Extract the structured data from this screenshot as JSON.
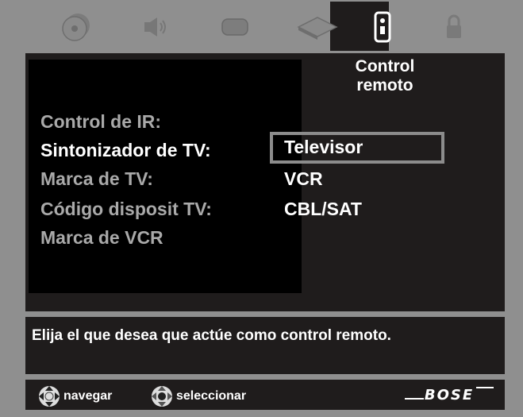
{
  "tabs": [
    {
      "icon": "disc-icon"
    },
    {
      "icon": "speaker-icon"
    },
    {
      "icon": "display-icon"
    },
    {
      "icon": "device-icon"
    },
    {
      "icon": "remote-icon",
      "active": true
    },
    {
      "icon": "lock-icon"
    }
  ],
  "page_title": "Control remoto",
  "menu": {
    "items": [
      {
        "label": "Control de IR:",
        "active": false
      },
      {
        "label": "Sintonizador de TV:",
        "active": true
      },
      {
        "label": "Marca de TV:",
        "active": false
      },
      {
        "label": "Código disposit TV:",
        "active": false
      },
      {
        "label": "Marca de VCR",
        "active": false
      }
    ],
    "options": [
      "Televisor",
      "VCR",
      "CBL/SAT"
    ],
    "selected_option": "Televisor"
  },
  "help_text": "Elija el que desea que actúe como control remoto.",
  "footer": {
    "navigate_label": "navegar",
    "select_label": "seleccionar",
    "brand": "BOSE"
  },
  "colors": {
    "panel": "#1f1c1c",
    "frame": "#8f8f8f",
    "inactive_text": "#a9a9a9",
    "active_text": "#ffffff"
  }
}
